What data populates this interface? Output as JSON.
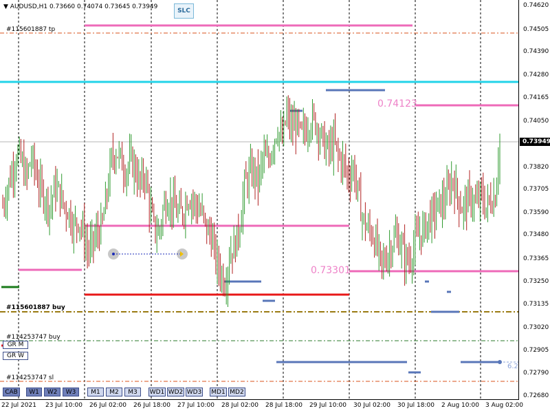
{
  "header": {
    "symbol": "AUDUSD,H1",
    "ohlc": "0.73660 0.74074 0.73645 0.73949"
  },
  "toolbar": {
    "slc_label": "SLC"
  },
  "orders": {
    "tp_label": "#115601887 tp",
    "buy1_label": "#115601887 buy",
    "buy2_label": "#114253747 buy",
    "sl_label": "#114253747 sl"
  },
  "price_tags": {
    "upper": "0.74123",
    "lower": "0.73301"
  },
  "gr_buttons": [
    "GR M",
    "GR W"
  ],
  "timeframe_buttons": [
    "CAB",
    "W1",
    "W2",
    "W3",
    "M1",
    "M2",
    "M3",
    "WD1",
    "WD2",
    "WD3",
    "MD1",
    "MD2"
  ],
  "price_axis": {
    "labels": [
      "0.74620",
      "0.74505",
      "0.74390",
      "0.74280",
      "0.74165",
      "0.74050",
      "0.73949",
      "0.73820",
      "0.73705",
      "0.73590",
      "0.73480",
      "0.73365",
      "0.73250",
      "0.73135",
      "0.73020",
      "0.72905",
      "0.72790",
      "0.72680"
    ],
    "current": "0.73949"
  },
  "time_axis": {
    "labels": [
      "22 Jul 2021",
      "23 Jul 10:00",
      "26 Jul 02:00",
      "26 Jul 18:00",
      "27 Jul 10:00",
      "28 Jul 02:00",
      "28 Jul 18:00",
      "29 Jul 10:00",
      "30 Jul 02:00",
      "30 Jul 18:00",
      "2 Aug 10:00",
      "3 Aug 02:00"
    ]
  },
  "right_value": "6.2",
  "colors": {
    "up_candle": "#2e9a2e",
    "down_candle": "#b02020",
    "pink": "#ee6ab8",
    "cyan": "#22d3e8",
    "red": "#e81818",
    "blue_seg": "#5876b8",
    "olive": "#9a7a10",
    "green_dash": "#2a7a2a",
    "orange_dash": "#d8501a"
  },
  "chart_data": {
    "type": "candlestick",
    "symbol": "AUDUSD",
    "timeframe": "H1",
    "ylim": [
      0.7268,
      0.7462
    ],
    "x_ticks": [
      "22 Jul 2021",
      "23 Jul 10:00",
      "26 Jul 02:00",
      "26 Jul 18:00",
      "27 Jul 10:00",
      "28 Jul 02:00",
      "28 Jul 18:00",
      "29 Jul 10:00",
      "30 Jul 02:00",
      "30 Jul 18:00",
      "2 Aug 10:00",
      "3 Aug 02:00"
    ],
    "close_path": [
      0.7362,
      0.7371,
      0.7379,
      0.7388,
      0.7383,
      0.7375,
      0.7386,
      0.7378,
      0.737,
      0.7366,
      0.7362,
      0.7371,
      0.7368,
      0.7362,
      0.7359,
      0.7352,
      0.7356,
      0.7349,
      0.734,
      0.7344,
      0.7349,
      0.7352,
      0.7368,
      0.7385,
      0.7389,
      0.7384,
      0.7379,
      0.7384,
      0.738,
      0.7372,
      0.7378,
      0.7362,
      0.7351,
      0.7349,
      0.7362,
      0.7366,
      0.7362,
      0.7358,
      0.7359,
      0.7366,
      0.7366,
      0.7361,
      0.7359,
      0.7351,
      0.7348,
      0.7336,
      0.733,
      0.7325,
      0.734,
      0.7342,
      0.7352,
      0.7371,
      0.7377,
      0.7379,
      0.7374,
      0.7386,
      0.7383,
      0.7392,
      0.74,
      0.7393,
      0.7407,
      0.7399,
      0.7402,
      0.7396,
      0.7399,
      0.7404,
      0.7403,
      0.7398,
      0.7391,
      0.7389,
      0.7393,
      0.7385,
      0.7383,
      0.7376,
      0.7381,
      0.7369,
      0.7356,
      0.7351,
      0.7349,
      0.7342,
      0.7333,
      0.7337,
      0.7343,
      0.7347,
      0.7344,
      0.7336,
      0.7336,
      0.7344,
      0.7348,
      0.7351,
      0.7356,
      0.7358,
      0.7362,
      0.7364,
      0.7368,
      0.7376,
      0.7367,
      0.7361,
      0.7364,
      0.7366,
      0.7362,
      0.7368,
      0.7361,
      0.7365,
      0.7366,
      0.7395
    ],
    "horizontal_levels": [
      {
        "price": 0.74123,
        "label": "0.74123"
      },
      {
        "price": 0.73301,
        "label": "0.73301"
      }
    ],
    "current_price": 0.73949
  }
}
